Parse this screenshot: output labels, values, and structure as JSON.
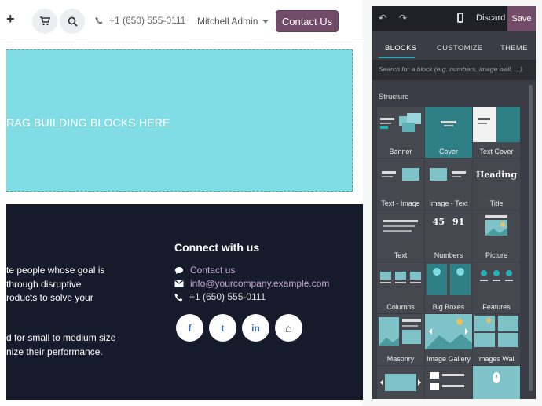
{
  "topbar": {
    "phone": "+1 (650) 555-0111",
    "user": "Mitchell Admin",
    "contact_button": "Contact Us"
  },
  "dropzone": {
    "text": "RAG BUILDING BLOCKS HERE"
  },
  "footer": {
    "about_lines": [
      "te people whose goal is",
      "through disruptive",
      "roducts to solve your"
    ],
    "about_lines2": [
      "d  for small to medium size",
      "nize their performance."
    ],
    "connect_title": "Connect with us",
    "contact_link": "Contact us",
    "email": "info@yourcompany.example.com",
    "phone": "+1 (650) 555-0111",
    "social": [
      {
        "icon": "facebook-icon",
        "glyph": "f"
      },
      {
        "icon": "twitter-icon",
        "glyph": "t"
      },
      {
        "icon": "linkedin-icon",
        "glyph": "in"
      },
      {
        "icon": "home-icon",
        "glyph": "⌂"
      }
    ]
  },
  "panel": {
    "discard": "Discard",
    "save": "Save",
    "tabs": [
      "BLOCKS",
      "CUSTOMIZE",
      "THEME"
    ],
    "search_placeholder": "Search for a block (e.g. numbers, image wall, ...)",
    "section_title": "Structure",
    "blocks": [
      "Banner",
      "Cover",
      "Text Cover",
      "Text - Image",
      "Image - Text",
      "Title",
      "Text",
      "Numbers",
      "Picture",
      "Columns",
      "Big Boxes",
      "Features",
      "Masonry",
      "Image Gallery",
      "Images Wall"
    ],
    "title_thumb_text": "Heading",
    "numbers_thumb": [
      "45",
      "91"
    ]
  },
  "colors": {
    "accent": "#714b67",
    "teal": "#27b1b8",
    "dropzone": "#80dde6",
    "footer_bg": "#161b2b",
    "panel_bg": "#3a3d45"
  }
}
